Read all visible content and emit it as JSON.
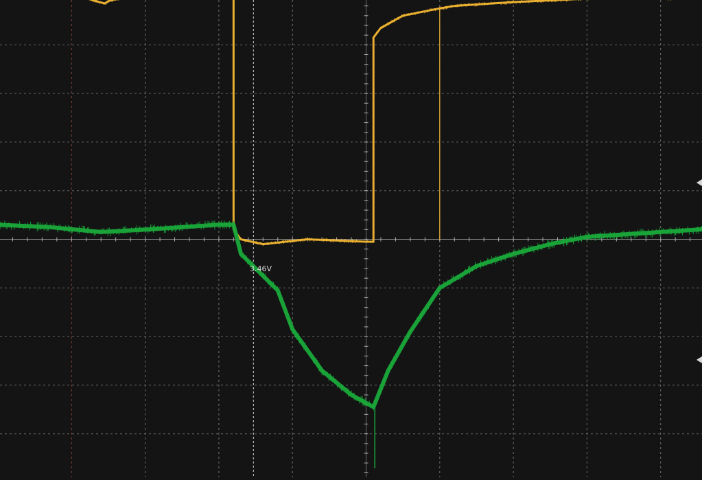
{
  "chart_data": {
    "type": "line",
    "title": "",
    "xlabel": "",
    "ylabel": "",
    "grid": true,
    "xlim": [
      0,
      10
    ],
    "ylim": [
      -6,
      6
    ],
    "x_divisions": 10,
    "y_divisions": 12,
    "background_color": "#141414",
    "grid_color": "#9a9a9a",
    "series": [
      {
        "color": "#f2b632",
        "x": [
          0,
          1.1,
          1.45,
          1.5,
          1.75,
          3.2,
          3.2,
          3.3,
          3.6,
          4.2,
          5.0,
          5.1,
          5.1,
          5.2,
          5.5,
          6.0,
          6.2,
          7.0,
          8.0,
          9.0,
          9.1,
          10
        ],
        "y": [
          5.0,
          5.0,
          4.85,
          4.9,
          5.0,
          5.0,
          0.2,
          0.0,
          -0.1,
          -0.0,
          -0.05,
          -0.05,
          4.15,
          4.35,
          4.6,
          4.75,
          4.8,
          4.88,
          4.95,
          5.05,
          4.95,
          5.05
        ]
      },
      {
        "color": "#1aa83a",
        "x": [
          0,
          0.7,
          1.4,
          2.0,
          3.0,
          3.2,
          3.3,
          3.5,
          3.8,
          4.0,
          4.4,
          4.8,
          5.1,
          5.3,
          5.6,
          6.0,
          6.5,
          7.0,
          7.5,
          8.0,
          8.5,
          9.0,
          9.5,
          10
        ],
        "y": [
          0.3,
          0.25,
          0.15,
          0.2,
          0.3,
          0.3,
          -0.3,
          -0.6,
          -1.05,
          -1.85,
          -2.7,
          -3.2,
          -3.45,
          -2.7,
          -1.9,
          -1.0,
          -0.55,
          -0.3,
          -0.1,
          0.05,
          0.1,
          0.15,
          0.2,
          0.25
        ]
      }
    ],
    "annotations": [
      {
        "text": "3.46V",
        "color": "#d8d8d8"
      }
    ]
  }
}
